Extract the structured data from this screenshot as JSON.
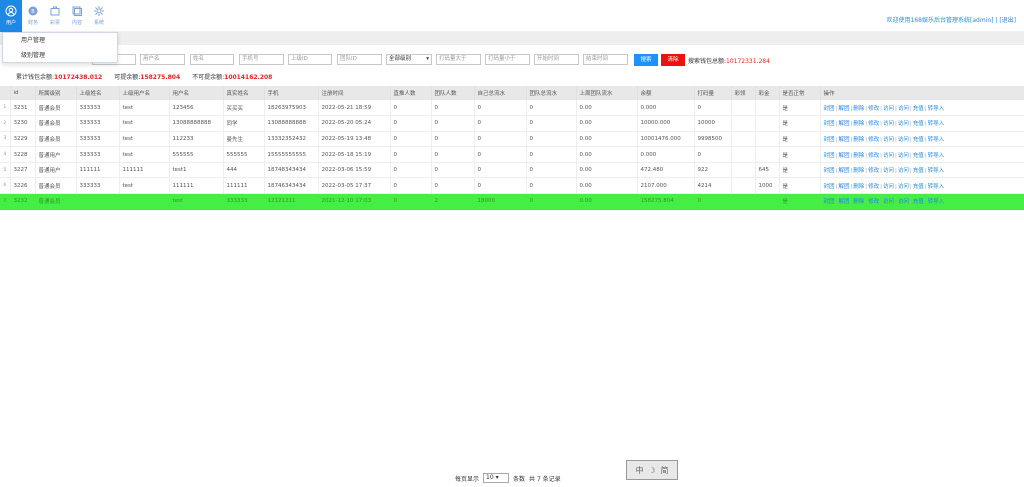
{
  "nav": [
    {
      "label": "用户",
      "icon": "user-icon",
      "active": true
    },
    {
      "label": "财务",
      "icon": "finance-icon"
    },
    {
      "label": "彩票",
      "icon": "lottery-icon"
    },
    {
      "label": "内容",
      "icon": "content-icon"
    },
    {
      "label": "系统",
      "icon": "settings-icon"
    }
  ],
  "welcome": "欢迎使用168娱乐后台管理系统[admin] | [退出]",
  "dropdown": [
    "用户管理",
    "级别管理"
  ],
  "filters": {
    "username": "用户名",
    "name": "姓名",
    "phone": "手机号",
    "parent_id": "上级ID",
    "team_id": "团队ID",
    "level_select": "全部级别",
    "bet_gt": "打码量大于",
    "bet_lt": "打码量小于",
    "start_time": "开始时间",
    "end_time": "结束时间",
    "search_label": "搜索",
    "clear_label": "清除",
    "agg_label": "搜索钱包总额:",
    "agg_value": "10172331.284"
  },
  "summary": {
    "total_label": "累计钱包余额:",
    "total_value": "10172438.012",
    "withdrawable_label": "可提余额:",
    "withdrawable_value": "158275.804",
    "not_withdrawable_label": "不可提余额:",
    "not_withdrawable_value": "10014162.208"
  },
  "columns": [
    "id",
    "所属级别",
    "上级姓名",
    "上级用户名",
    "用户名",
    "真实姓名",
    "手机",
    "注册时间",
    "直推人数",
    "团队人数",
    "自己总流水",
    "团队总流水",
    "上周团队流水",
    "余额",
    "打码量",
    "彩领",
    "彩金",
    "是否正常",
    "操作"
  ],
  "rows": [
    [
      "1",
      "3231",
      "普通会员",
      "333333",
      "test",
      "123456",
      "买买买",
      "18263975903",
      "2022-05-21 18:59",
      "0",
      "0",
      "0",
      "0",
      "0.00",
      "0.000",
      "0",
      "",
      "",
      "是"
    ],
    [
      "2",
      "3230",
      "普通会员",
      "333333",
      "test",
      "13088888888",
      "同学",
      "13088888888",
      "2022-05-20 05:24",
      "0",
      "0",
      "0",
      "0",
      "0.00",
      "10000.000",
      "10000",
      "",
      "",
      "是"
    ],
    [
      "3",
      "3229",
      "普通会员",
      "333333",
      "test",
      "112233",
      "曼先生",
      "13332352432",
      "2022-05-19 13:48",
      "0",
      "0",
      "0",
      "0",
      "0.00",
      "10001476.000",
      "9998500",
      "",
      "",
      "是"
    ],
    [
      "4",
      "3228",
      "普通用户",
      "333333",
      "test",
      "555555",
      "555555",
      "15555555555",
      "2022-05-18 15:19",
      "0",
      "0",
      "0",
      "0",
      "0.00",
      "0.000",
      "0",
      "",
      "",
      "是"
    ],
    [
      "5",
      "3227",
      "普通用户",
      "111111",
      "111111",
      "test1",
      "444",
      "18748343434",
      "2022-03-06 15:59",
      "0",
      "0",
      "0",
      "0",
      "0.00",
      "472.480",
      "922",
      "",
      "645",
      "是"
    ],
    [
      "6",
      "3226",
      "普通会员",
      "333333",
      "test",
      "111111",
      "111111",
      "18746343434",
      "2022-03-05 17:37",
      "0",
      "0",
      "0",
      "0",
      "0.00",
      "2107.000",
      "4214",
      "",
      "1000",
      "是"
    ],
    [
      "7",
      "3232",
      "普通会员",
      "",
      "",
      "test",
      "333333",
      "12121211",
      "2021-12-10 17:03",
      "0",
      "2",
      "18000",
      "0",
      "0.00",
      "158275.804",
      "0",
      "",
      "",
      "是"
    ]
  ],
  "actions": [
    "封团",
    "解团",
    "删除",
    "修改",
    "访问",
    "访问",
    "充值",
    "转导入"
  ],
  "pager": {
    "per_page_label": "每页显示",
    "per_page_value": "10",
    "unit": "条数",
    "total": "共 7 条记录"
  },
  "ime": [
    "中",
    "☽",
    "简"
  ],
  "colors": {
    "primary": "#1e88e5",
    "danger": "#ee1111",
    "highlight": "#44ee44"
  }
}
